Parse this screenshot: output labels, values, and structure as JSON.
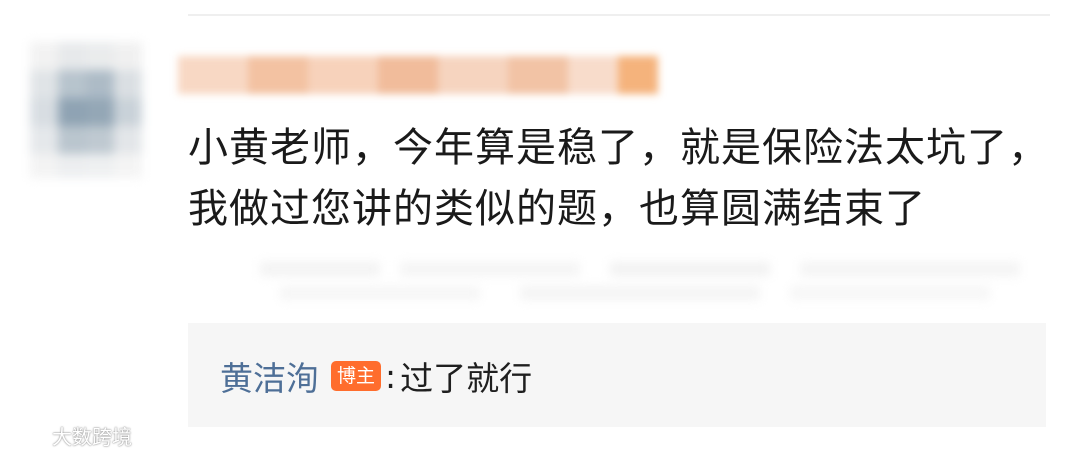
{
  "comment": {
    "text": "小黄老师，今年算是稳了，就是保险法太坑了，我做过您讲的类似的题，也算圆满结束了"
  },
  "reply": {
    "author": "黄洁洵",
    "badge": "博主",
    "separator": ":",
    "text": "过了就行"
  },
  "watermark": {
    "text": "大数跨境",
    "icon": "brand-logo-icon"
  },
  "colors": {
    "reply_author": "#4e6f97",
    "badge_bg": "#ff6d2d",
    "reply_bg": "#f6f6f6",
    "text": "#1a1a1a"
  }
}
